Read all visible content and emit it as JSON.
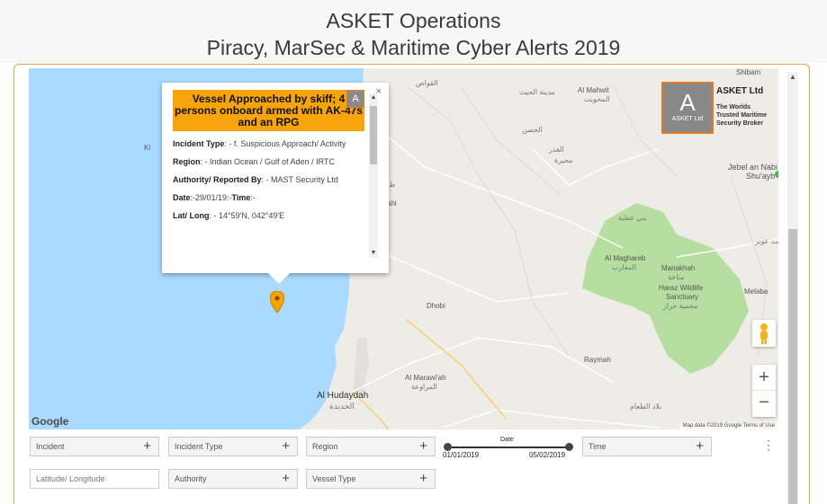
{
  "header": {
    "title_line1": "ASKET Operations",
    "title_line2": "Piracy, MarSec & Maritime Cyber Alerts 2019"
  },
  "popup": {
    "headline": "Vessel Approached by skiff; 4 persons onboard armed with AK-47s and an RPG",
    "logo_letter": "A",
    "close": "×",
    "incident_type_label": "Incident Type",
    "incident_type_value": ": - f. Suspicious Approach/ Activity",
    "region_label": "Region",
    "region_value": ": - Indian Ocean / Gulf of Aden / IRTC",
    "authority_label": "Authority/ Reported By",
    "authority_value": ": - MAST Security Ltd",
    "date_label": "Date",
    "date_value": ":-29/01/19:-",
    "time_label": "Time",
    "time_value": ":-",
    "latlong_label": "Lat/ Long",
    "latlong_value": ": - 14°59'N, 042°49'E"
  },
  "brand": {
    "letter": "A",
    "sub": "ASKET Ltd",
    "name": "ASKET Ltd",
    "tagline": [
      "The Worlds",
      "Trusted Maritime",
      "Security Broker"
    ]
  },
  "map": {
    "labels": [
      {
        "text": "Shibam",
        "ar": false
      },
      {
        "text": "القواص",
        "ar": true
      },
      {
        "text": "مدينة الحيث",
        "ar": true
      },
      {
        "text": "Al Mahwit",
        "ar": false
      },
      {
        "text": "المحويت",
        "ar": true
      },
      {
        "text": "الحصن",
        "ar": true
      },
      {
        "text": "الغدر",
        "ar": true
      },
      {
        "text": "محيرة",
        "ar": true
      },
      {
        "text": "Jebel an Nabi",
        "ar": false
      },
      {
        "text": "Shu'ayb",
        "ar": false
      },
      {
        "text": "بني عطية",
        "ar": true
      },
      {
        "text": "بيت عوبر",
        "ar": true
      },
      {
        "text": "Al Maghareb",
        "ar": false
      },
      {
        "text": "المغارب",
        "ar": true
      },
      {
        "text": "Manakhah",
        "ar": false
      },
      {
        "text": "مناخة",
        "ar": true
      },
      {
        "text": "Haraz Wildlife",
        "ar": false
      },
      {
        "text": "Sanctuary",
        "ar": false
      },
      {
        "text": "محمية حراز",
        "ar": true
      },
      {
        "text": "Melaba",
        "ar": false
      },
      {
        "text": "Dhobi",
        "ar": false
      },
      {
        "text": "Raymah",
        "ar": false
      },
      {
        "text": "Al Marawi'ah",
        "ar": false
      },
      {
        "text": "المراوعة",
        "ar": true
      },
      {
        "text": "Al Hudaydah",
        "ar": false
      },
      {
        "text": "الحديدة",
        "ar": true
      },
      {
        "text": "بلاد الطعام",
        "ar": true
      },
      {
        "text": "Ki",
        "ar": false
      },
      {
        "text": "ahi",
        "ar": false
      },
      {
        "text": "ظ",
        "ar": true
      }
    ],
    "google": "Google",
    "attribution": "Map data ©2019 Google    Terms of Use",
    "zoom_in": "+",
    "zoom_out": "−"
  },
  "filters": {
    "incident": "Incident",
    "incident_type": "Incident Type",
    "region": "Region",
    "time": "Time",
    "authority": "Authority",
    "vessel_type": "Vessel Type",
    "latlong_placeholder": "Latitude/ Longitude",
    "plus": "+"
  },
  "date_slider": {
    "label": "Date",
    "start": "01/01/2019",
    "end": "05/02/2019"
  },
  "colors": {
    "sea": "#aadaff",
    "land": "#eeece6",
    "park": "#b6dea0",
    "accent": "#e07b2a",
    "headline_bg": "#f5a40b",
    "marker": "#f4a300"
  }
}
